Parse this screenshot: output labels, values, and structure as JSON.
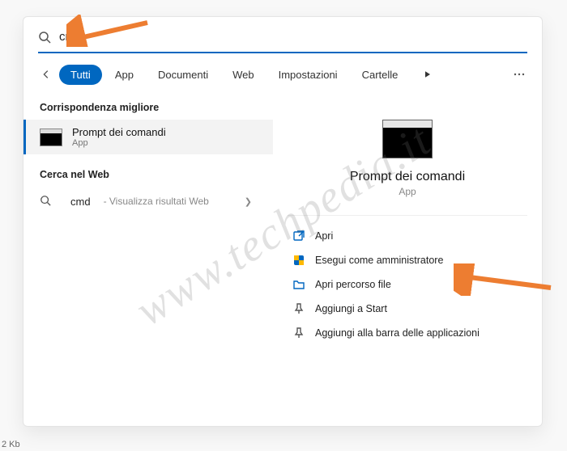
{
  "search": {
    "value": "cmd"
  },
  "tabs": {
    "all": "Tutti",
    "app": "App",
    "documents": "Documenti",
    "web": "Web",
    "settings": "Impostazioni",
    "folders": "Cartelle"
  },
  "sections": {
    "best_match": "Corrispondenza migliore",
    "web_search": "Cerca nel Web"
  },
  "best_match": {
    "title": "Prompt dei comandi",
    "subtitle": "App"
  },
  "web": {
    "query": "cmd",
    "hint": "- Visualizza risultati Web"
  },
  "preview": {
    "title": "Prompt dei comandi",
    "subtitle": "App"
  },
  "actions": {
    "open": "Apri",
    "run_admin": "Esegui come amministratore",
    "open_location": "Apri percorso file",
    "pin_start": "Aggiungi a Start",
    "pin_taskbar": "Aggiungi alla barra delle applicazioni"
  },
  "watermark": "www.techpedia.it",
  "status": "2 Kb"
}
